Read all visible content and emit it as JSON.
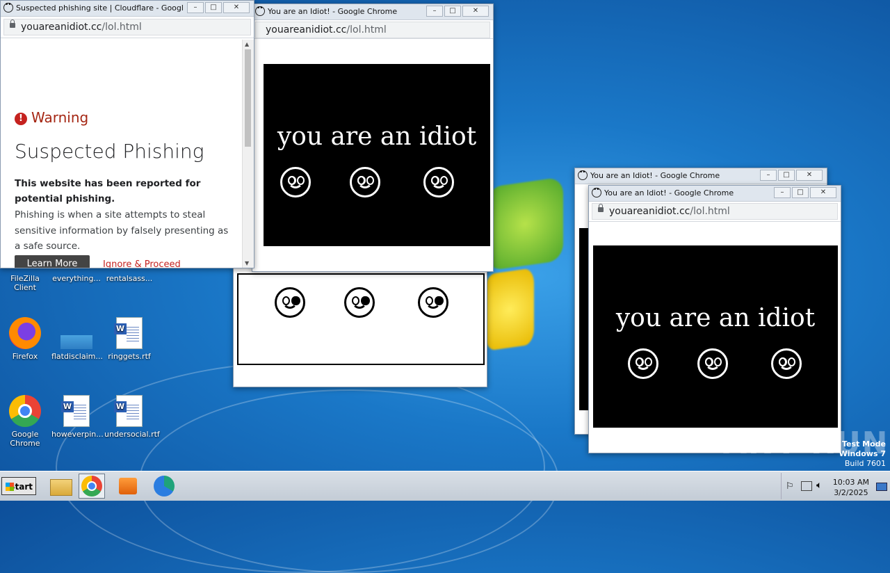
{
  "desktop": {
    "icons": [
      {
        "label": "FileZilla Client"
      },
      {
        "label": "everything..."
      },
      {
        "label": "rentalsass..."
      },
      {
        "label": "Firefox"
      },
      {
        "label": "flatdisclaim..."
      },
      {
        "label": "ringgets.rtf"
      },
      {
        "label": "Google Chrome"
      },
      {
        "label": "howeverpin..."
      },
      {
        "label": "undersocial.rtf"
      }
    ],
    "watermark": {
      "line1": "Test Mode",
      "line2": "Windows 7",
      "line3": "Build 7601"
    },
    "brand_text": "ANY RUN"
  },
  "phishing_window": {
    "title": "Suspected phishing site | Cloudflare - Google C...",
    "url_host": "youareanidiot.cc",
    "url_path": "/lol.html",
    "warning_label": "Warning",
    "heading": "Suspected Phishing",
    "bold_text": "This website has been reported for potential phishing.",
    "body_text": "Phishing is when a site attempts to steal sensitive information by falsely presenting as a safe source.",
    "learn_more": "Learn More",
    "ignore_proceed": "Ignore & Proceed"
  },
  "idiot_windows": [
    {
      "title": "You are an Idiot! - Google Chrome",
      "url_host": "youareanidiot.cc",
      "url_path": "/lol.html",
      "text": "you are an idiot",
      "address_peek": "Yo"
    },
    {
      "title": "You are an Idiot! - Google Chrome"
    },
    {
      "title": "You are an Idiot! - Google Chrome",
      "url_host": "youareanidiot.cc",
      "url_path": "/lol.html",
      "text": "you are an idiot"
    }
  ],
  "taskbar": {
    "start_label": "Start",
    "clock_time": "10:03 AM",
    "clock_date": "3/2/2025"
  }
}
